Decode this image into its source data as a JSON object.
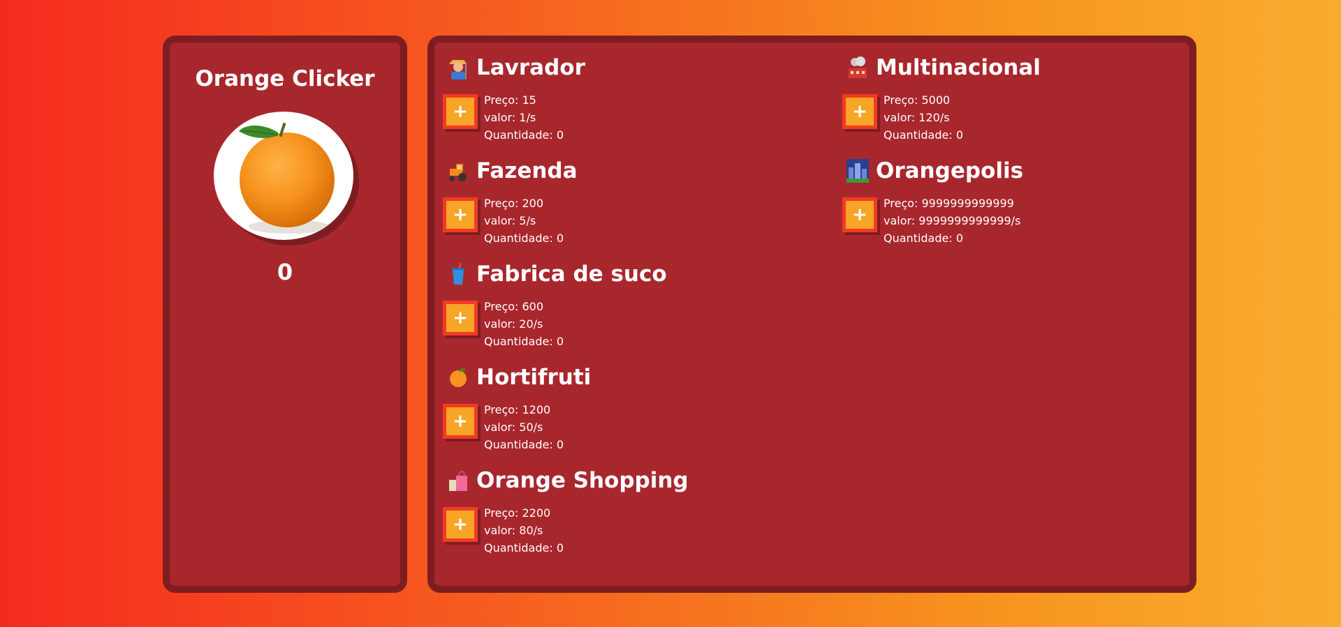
{
  "game": {
    "title": "Orange Clicker",
    "count": "0",
    "orange_icon": "orange-fruit-image"
  },
  "labels": {
    "price": "Preço: ",
    "value": "valor: ",
    "quantity": "Quantidade: ",
    "buy_button": "+"
  },
  "items": [
    {
      "icon": "farmer-icon",
      "name": "Lavrador",
      "price": "15",
      "value": "1/s",
      "quantity": "0"
    },
    {
      "icon": "tractor-icon",
      "name": "Fazenda",
      "price": "200",
      "value": "5/s",
      "quantity": "0"
    },
    {
      "icon": "juice-cup-icon",
      "name": "Fabrica de suco",
      "price": "600",
      "value": "20/s",
      "quantity": "0"
    },
    {
      "icon": "tangerine-icon",
      "name": "Hortifruti",
      "price": "1200",
      "value": "50/s",
      "quantity": "0"
    },
    {
      "icon": "shopping-bags-icon",
      "name": "Orange Shopping",
      "price": "2200",
      "value": "80/s",
      "quantity": "0"
    },
    {
      "icon": "factory-icon",
      "name": "Multinacional",
      "price": "5000",
      "value": "120/s",
      "quantity": "0"
    },
    {
      "icon": "city-icon",
      "name": "Orangepolis",
      "price": "9999999999999",
      "value": "9999999999999/s",
      "quantity": "0"
    }
  ],
  "colors": {
    "panel": "#a8272d",
    "panel_border": "#7d1d21",
    "button": "#f7a526",
    "button_border": "#f23b22"
  }
}
